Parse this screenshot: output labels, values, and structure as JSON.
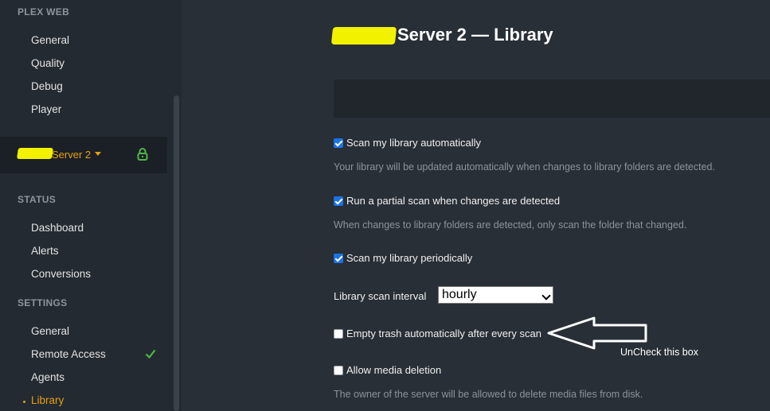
{
  "sidebar": {
    "plex_web_title": "PLEX WEB",
    "plex_web_items": [
      "General",
      "Quality",
      "Debug",
      "Player"
    ],
    "server_name": "Server 2",
    "status_title": "STATUS",
    "status_items": [
      "Dashboard",
      "Alerts",
      "Conversions"
    ],
    "settings_title": "SETTINGS",
    "settings_items": [
      "General",
      "Remote Access",
      "Agents",
      "Library"
    ],
    "active_item": "Library"
  },
  "main": {
    "title": "Server 2 — Library",
    "settings": [
      {
        "label": "Scan my library automatically",
        "checked": true,
        "hint": "Your library will be updated automatically when changes to library folders are detected."
      },
      {
        "label": "Run a partial scan when changes are detected",
        "checked": true,
        "hint": "When changes to library folders are detected, only scan the folder that changed."
      },
      {
        "label": "Scan my library periodically",
        "checked": true,
        "hint": ""
      },
      {
        "label": "Empty trash automatically after every scan",
        "checked": false,
        "hint": ""
      },
      {
        "label": "Allow media deletion",
        "checked": false,
        "hint": "The owner of the server will be allowed to delete media files from disk."
      }
    ],
    "scan_interval": {
      "label": "Library scan interval",
      "value": "hourly"
    }
  },
  "annotation": {
    "text": "UnCheck this box"
  },
  "colors": {
    "accent": "#e5a00d",
    "background": "#282f37",
    "sidebar": "#232a31",
    "highlight": "#f2f200"
  }
}
